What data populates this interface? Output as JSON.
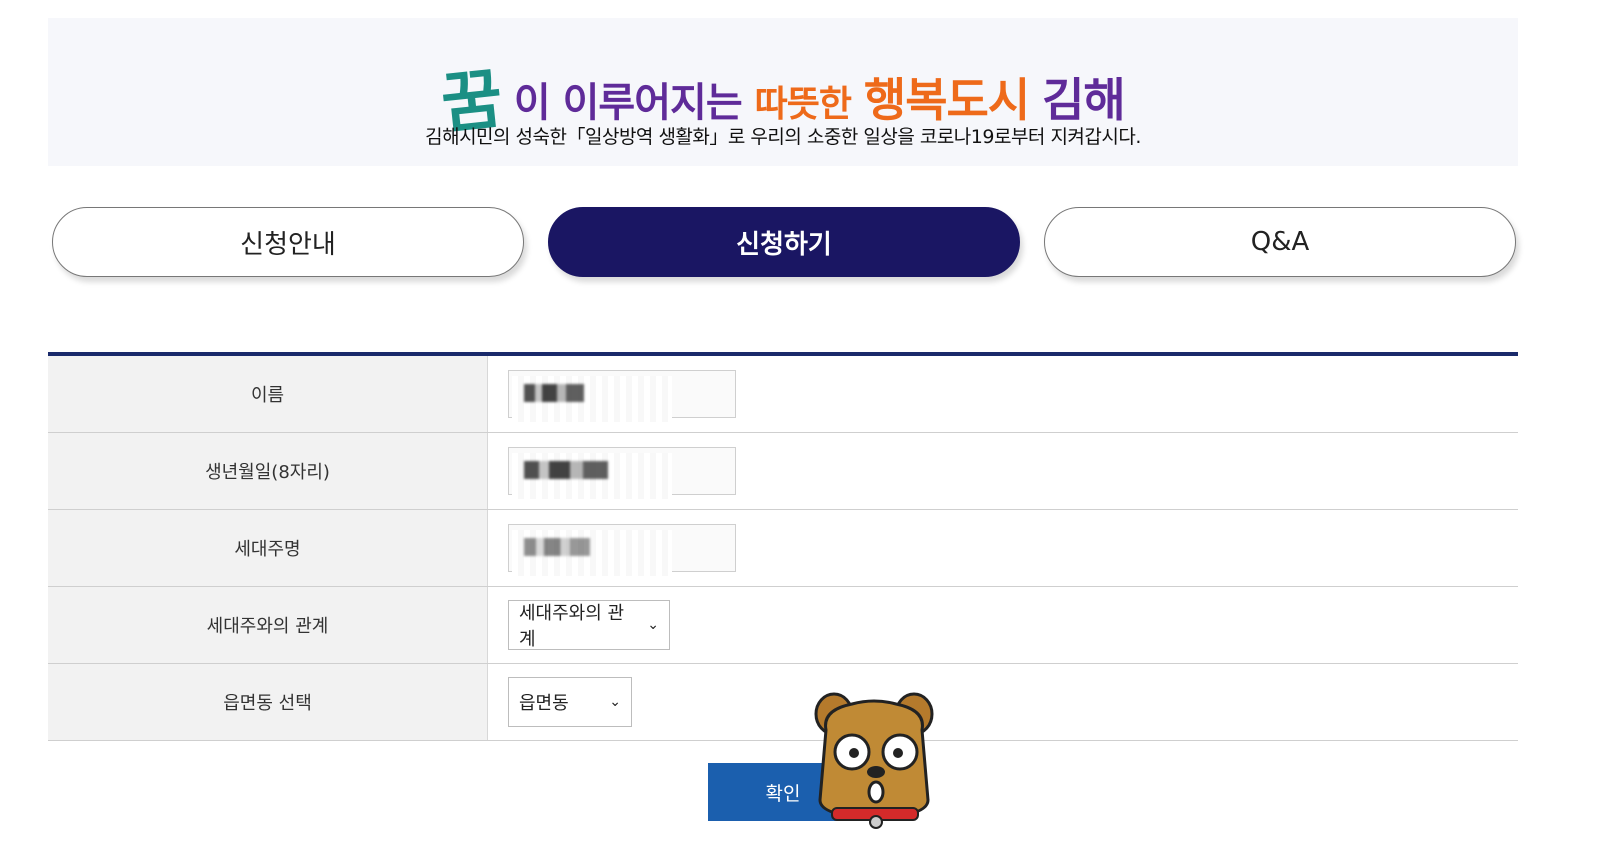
{
  "banner": {
    "title_dream": "꿈",
    "title_part1": "이 이루어지는",
    "title_part2": "따뜻한",
    "title_part3": "행복도시",
    "title_part4": "김해",
    "subtitle": "김해시민의 성숙한「일상방역 생활화」로 우리의 소중한 일상을 코로나19로부터 지켜갑시다."
  },
  "tabs": [
    {
      "label": "신청안내",
      "active": false
    },
    {
      "label": "신청하기",
      "active": true
    },
    {
      "label": "Q&A",
      "active": false
    }
  ],
  "form": {
    "rows": [
      {
        "label": "이름",
        "type": "text",
        "value": ""
      },
      {
        "label": "생년월일(8자리)",
        "type": "text",
        "value": ""
      },
      {
        "label": "세대주명",
        "type": "text",
        "value": ""
      },
      {
        "label": "세대주와의 관계",
        "type": "select",
        "value": "세대주와의 관계"
      },
      {
        "label": "읍면동 선택",
        "type": "select",
        "value": "읍면동"
      }
    ],
    "submit_label": "확인"
  },
  "colors": {
    "active_tab": "#1a1663",
    "form_top_border": "#1a2a6b",
    "submit_button": "#1b5fae",
    "banner_bg": "#f6f7fb"
  }
}
